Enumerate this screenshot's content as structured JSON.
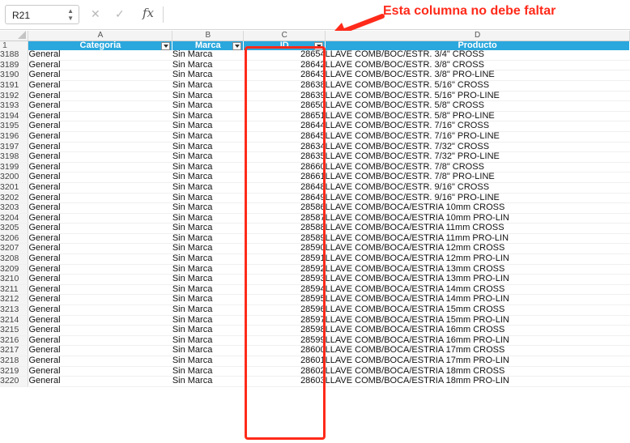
{
  "formula_bar": {
    "name_box": "R21",
    "fx_label": "fx"
  },
  "annotation": {
    "text": "Esta columna no debe faltar",
    "color": "#ff2a1a"
  },
  "columns": {
    "A": "A",
    "B": "B",
    "C": "C",
    "D": "D"
  },
  "header_row": {
    "row_number": "1",
    "categoria": "Categoria",
    "marca": "Marca",
    "id": "ID",
    "producto": "Producto",
    "color": "#2aa7dd"
  },
  "rows": [
    {
      "row": "3188",
      "categoria": "General",
      "marca": "Sin Marca",
      "id": "28654",
      "producto": "LLAVE COMB/BOC/ESTR. 3/4\" CROSS"
    },
    {
      "row": "3189",
      "categoria": "General",
      "marca": "Sin Marca",
      "id": "28642",
      "producto": "LLAVE COMB/BOC/ESTR. 3/8\" CROSS"
    },
    {
      "row": "3190",
      "categoria": "General",
      "marca": "Sin Marca",
      "id": "28643",
      "producto": "LLAVE COMB/BOC/ESTR. 3/8\" PRO-LINE"
    },
    {
      "row": "3191",
      "categoria": "General",
      "marca": "Sin Marca",
      "id": "28638",
      "producto": "LLAVE COMB/BOC/ESTR. 5/16\" CROSS"
    },
    {
      "row": "3192",
      "categoria": "General",
      "marca": "Sin Marca",
      "id": "28639",
      "producto": "LLAVE COMB/BOC/ESTR. 5/16\" PRO-LINE"
    },
    {
      "row": "3193",
      "categoria": "General",
      "marca": "Sin Marca",
      "id": "28650",
      "producto": "LLAVE COMB/BOC/ESTR. 5/8\" CROSS"
    },
    {
      "row": "3194",
      "categoria": "General",
      "marca": "Sin Marca",
      "id": "28651",
      "producto": "LLAVE COMB/BOC/ESTR. 5/8\" PRO-LINE"
    },
    {
      "row": "3195",
      "categoria": "General",
      "marca": "Sin Marca",
      "id": "28644",
      "producto": "LLAVE COMB/BOC/ESTR. 7/16\" CROSS"
    },
    {
      "row": "3196",
      "categoria": "General",
      "marca": "Sin Marca",
      "id": "28645",
      "producto": "LLAVE COMB/BOC/ESTR. 7/16\" PRO-LINE"
    },
    {
      "row": "3197",
      "categoria": "General",
      "marca": "Sin Marca",
      "id": "28634",
      "producto": "LLAVE COMB/BOC/ESTR. 7/32\" CROSS"
    },
    {
      "row": "3198",
      "categoria": "General",
      "marca": "Sin Marca",
      "id": "28635",
      "producto": "LLAVE COMB/BOC/ESTR. 7/32\" PRO-LINE"
    },
    {
      "row": "3199",
      "categoria": "General",
      "marca": "Sin Marca",
      "id": "28660",
      "producto": "LLAVE COMB/BOC/ESTR. 7/8\" CROSS"
    },
    {
      "row": "3200",
      "categoria": "General",
      "marca": "Sin Marca",
      "id": "28661",
      "producto": "LLAVE COMB/BOC/ESTR. 7/8\" PRO-LINE"
    },
    {
      "row": "3201",
      "categoria": "General",
      "marca": "Sin Marca",
      "id": "28648",
      "producto": "LLAVE COMB/BOC/ESTR. 9/16\" CROSS"
    },
    {
      "row": "3202",
      "categoria": "General",
      "marca": "Sin Marca",
      "id": "28649",
      "producto": "LLAVE COMB/BOC/ESTR. 9/16\" PRO-LINE"
    },
    {
      "row": "3203",
      "categoria": "General",
      "marca": "Sin Marca",
      "id": "28586",
      "producto": "LLAVE COMB/BOCA/ESTRIA 10mm CROSS"
    },
    {
      "row": "3204",
      "categoria": "General",
      "marca": "Sin Marca",
      "id": "28587",
      "producto": "LLAVE COMB/BOCA/ESTRIA 10mm PRO-LIN"
    },
    {
      "row": "3205",
      "categoria": "General",
      "marca": "Sin Marca",
      "id": "28588",
      "producto": "LLAVE COMB/BOCA/ESTRIA 11mm CROSS"
    },
    {
      "row": "3206",
      "categoria": "General",
      "marca": "Sin Marca",
      "id": "28589",
      "producto": "LLAVE COMB/BOCA/ESTRIA 11mm PRO-LIN"
    },
    {
      "row": "3207",
      "categoria": "General",
      "marca": "Sin Marca",
      "id": "28590",
      "producto": "LLAVE COMB/BOCA/ESTRIA 12mm CROSS"
    },
    {
      "row": "3208",
      "categoria": "General",
      "marca": "Sin Marca",
      "id": "28591",
      "producto": "LLAVE COMB/BOCA/ESTRIA 12mm PRO-LIN"
    },
    {
      "row": "3209",
      "categoria": "General",
      "marca": "Sin Marca",
      "id": "28592",
      "producto": "LLAVE COMB/BOCA/ESTRIA 13mm CROSS"
    },
    {
      "row": "3210",
      "categoria": "General",
      "marca": "Sin Marca",
      "id": "28593",
      "producto": "LLAVE COMB/BOCA/ESTRIA 13mm PRO-LIN"
    },
    {
      "row": "3211",
      "categoria": "General",
      "marca": "Sin Marca",
      "id": "28594",
      "producto": "LLAVE COMB/BOCA/ESTRIA 14mm CROSS"
    },
    {
      "row": "3212",
      "categoria": "General",
      "marca": "Sin Marca",
      "id": "28595",
      "producto": "LLAVE COMB/BOCA/ESTRIA 14mm PRO-LIN"
    },
    {
      "row": "3213",
      "categoria": "General",
      "marca": "Sin Marca",
      "id": "28596",
      "producto": "LLAVE COMB/BOCA/ESTRIA 15mm CROSS"
    },
    {
      "row": "3214",
      "categoria": "General",
      "marca": "Sin Marca",
      "id": "28597",
      "producto": "LLAVE COMB/BOCA/ESTRIA 15mm PRO-LIN"
    },
    {
      "row": "3215",
      "categoria": "General",
      "marca": "Sin Marca",
      "id": "28598",
      "producto": "LLAVE COMB/BOCA/ESTRIA 16mm CROSS"
    },
    {
      "row": "3216",
      "categoria": "General",
      "marca": "Sin Marca",
      "id": "28599",
      "producto": "LLAVE COMB/BOCA/ESTRIA 16mm PRO-LIN"
    },
    {
      "row": "3217",
      "categoria": "General",
      "marca": "Sin Marca",
      "id": "28600",
      "producto": "LLAVE COMB/BOCA/ESTRIA 17mm CROSS"
    },
    {
      "row": "3218",
      "categoria": "General",
      "marca": "Sin Marca",
      "id": "28601",
      "producto": "LLAVE COMB/BOCA/ESTRIA 17mm PRO-LIN"
    },
    {
      "row": "3219",
      "categoria": "General",
      "marca": "Sin Marca",
      "id": "28602",
      "producto": "LLAVE COMB/BOCA/ESTRIA 18mm CROSS"
    },
    {
      "row": "3220",
      "categoria": "General",
      "marca": "Sin Marca",
      "id": "28603",
      "producto": "LLAVE COMB/BOCA/ESTRIA 18mm PRO-LIN"
    }
  ]
}
